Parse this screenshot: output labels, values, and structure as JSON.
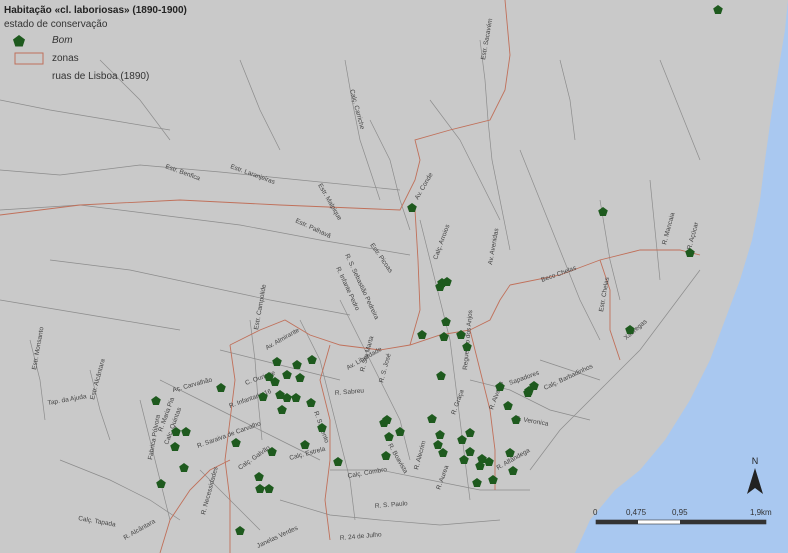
{
  "legend": {
    "title": "Habitação «cl. laboriosas» (1890-1900)",
    "subtitle": "estado de conservação",
    "items": [
      {
        "label": "Bom",
        "symbol": "pentagon-icon",
        "color": "#1e5a1e"
      },
      {
        "label": "zonas",
        "symbol": "outline-box-icon",
        "color": "#c0705a"
      },
      {
        "label": "ruas de Lisboa (1890)",
        "symbol": "none",
        "color": "#888888"
      }
    ]
  },
  "colors": {
    "land": "#c9c9c9",
    "water": "#a9c8f0",
    "streets": "#8c8c8c",
    "zones": "#c0705a",
    "marker": "#1e5a1e"
  },
  "streets": [
    "Estr. Sacavém",
    "Calç. Carriche",
    "Estr. Benfica",
    "Estr. Laranjeiras",
    "Estr. Malpique",
    "Estr. Palhavã",
    "Av. Conde",
    "Estr. Picoas",
    "R. Infante Pedro",
    "R. S. Sebastião Pedreira",
    "Av. Avenidas",
    "Calç. Arroios",
    "Estr. Campolide",
    "Av. Almirante",
    "R. Sabreu",
    "R. Infantaria 16",
    "Estr. Monsanto",
    "Estr. Alcântara",
    "Tap. da Ajuda",
    "R. S. Bento",
    "R. Saraiva de Carvalho",
    "Calç. Estrela",
    "Av. Liberdade",
    "R. Sta Marta",
    "R. S. José",
    "Calç. Combro",
    "R. Alecrim",
    "R. 24 de Julho",
    "R. S. Paulo",
    "R. Aurea",
    "R. Graça",
    "Sapadores",
    "Calç. Barbadinhos",
    "R. Alvares",
    "R. Veronica",
    "Estr. Chelas",
    "Beco Chelas",
    "R. Mancaia",
    "R. Açúcar",
    "Xabregas",
    "R. Boavista",
    "R. Necessidades",
    "Fabrica Pólvora",
    "Calç. Tapada",
    "R. Alcântara",
    "Janelas Verdes",
    "R. Alfândega",
    "Regueirão dos Anjos",
    "Calç. Galvão",
    "R. Maria Pia",
    "Calc. Quintas",
    "C. Ourique",
    "Aç. Carvalhão"
  ],
  "scale": {
    "ticks": [
      "0",
      "0,475",
      "0,95",
      "1,9"
    ],
    "unit": "km"
  },
  "north_label": "N",
  "map_data": {
    "markers": [
      [
        718,
        10
      ],
      [
        412,
        208
      ],
      [
        603,
        212
      ],
      [
        690,
        253
      ],
      [
        442,
        283
      ],
      [
        447,
        282
      ],
      [
        440,
        287
      ],
      [
        630,
        330
      ],
      [
        422,
        335
      ],
      [
        444,
        337
      ],
      [
        446,
        322
      ],
      [
        461,
        335
      ],
      [
        467,
        347
      ],
      [
        312,
        360
      ],
      [
        277,
        362
      ],
      [
        297,
        365
      ],
      [
        287,
        375
      ],
      [
        269,
        377
      ],
      [
        300,
        378
      ],
      [
        275,
        382
      ],
      [
        280,
        395
      ],
      [
        287,
        398
      ],
      [
        296,
        398
      ],
      [
        282,
        410
      ],
      [
        263,
        397
      ],
      [
        311,
        403
      ],
      [
        441,
        376
      ],
      [
        500,
        387
      ],
      [
        534,
        386
      ],
      [
        529,
        391
      ],
      [
        528,
        393
      ],
      [
        221,
        388
      ],
      [
        156,
        401
      ],
      [
        176,
        432
      ],
      [
        186,
        432
      ],
      [
        175,
        447
      ],
      [
        184,
        468
      ],
      [
        161,
        484
      ],
      [
        236,
        443
      ],
      [
        305,
        445
      ],
      [
        322,
        428
      ],
      [
        387,
        420
      ],
      [
        384,
        423
      ],
      [
        389,
        437
      ],
      [
        400,
        432
      ],
      [
        432,
        419
      ],
      [
        440,
        435
      ],
      [
        438,
        445
      ],
      [
        443,
        453
      ],
      [
        462,
        440
      ],
      [
        470,
        433
      ],
      [
        470,
        452
      ],
      [
        464,
        460
      ],
      [
        482,
        459
      ],
      [
        480,
        466
      ],
      [
        489,
        462
      ],
      [
        477,
        483
      ],
      [
        493,
        480
      ],
      [
        510,
        453
      ],
      [
        513,
        471
      ],
      [
        516,
        420
      ],
      [
        508,
        406
      ],
      [
        386,
        456
      ],
      [
        338,
        462
      ],
      [
        269,
        489
      ],
      [
        259,
        477
      ],
      [
        260,
        489
      ],
      [
        272,
        452
      ],
      [
        240,
        531
      ]
    ]
  }
}
